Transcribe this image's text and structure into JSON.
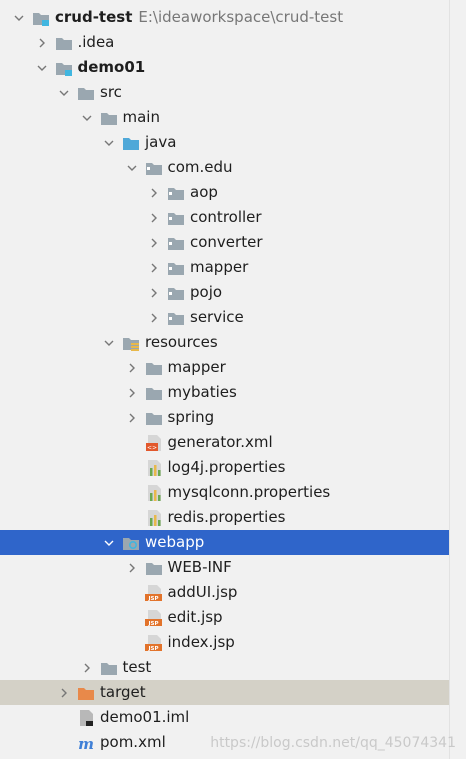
{
  "project": {
    "name": "crud-test",
    "path": "E:\\ideaworkspace\\crud-test"
  },
  "tree": [
    {
      "label": "crud-test",
      "depth": 0,
      "arrow": "down",
      "icon": "module-folder-icon",
      "bold": true,
      "path": "E:\\ideaworkspace\\crud-test"
    },
    {
      "label": ".idea",
      "depth": 1,
      "arrow": "right",
      "icon": "folder-icon"
    },
    {
      "label": "demo01",
      "depth": 1,
      "arrow": "down",
      "icon": "module-folder-icon",
      "bold": true
    },
    {
      "label": "src",
      "depth": 2,
      "arrow": "down",
      "icon": "folder-icon"
    },
    {
      "label": "main",
      "depth": 3,
      "arrow": "down",
      "icon": "folder-icon"
    },
    {
      "label": "java",
      "depth": 4,
      "arrow": "down",
      "icon": "source-folder-icon"
    },
    {
      "label": "com.edu",
      "depth": 5,
      "arrow": "down",
      "icon": "package-icon"
    },
    {
      "label": "aop",
      "depth": 6,
      "arrow": "right",
      "icon": "package-icon"
    },
    {
      "label": "controller",
      "depth": 6,
      "arrow": "right",
      "icon": "package-icon"
    },
    {
      "label": "converter",
      "depth": 6,
      "arrow": "right",
      "icon": "package-icon"
    },
    {
      "label": "mapper",
      "depth": 6,
      "arrow": "right",
      "icon": "package-icon"
    },
    {
      "label": "pojo",
      "depth": 6,
      "arrow": "right",
      "icon": "package-icon"
    },
    {
      "label": "service",
      "depth": 6,
      "arrow": "right",
      "icon": "package-icon"
    },
    {
      "label": "resources",
      "depth": 4,
      "arrow": "down",
      "icon": "resources-folder-icon"
    },
    {
      "label": "mapper",
      "depth": 5,
      "arrow": "right",
      "icon": "folder-icon"
    },
    {
      "label": "mybaties",
      "depth": 5,
      "arrow": "right",
      "icon": "folder-icon"
    },
    {
      "label": "spring",
      "depth": 5,
      "arrow": "right",
      "icon": "folder-icon"
    },
    {
      "label": "generator.xml",
      "depth": 5,
      "arrow": "none",
      "icon": "xml-file-icon"
    },
    {
      "label": "log4j.properties",
      "depth": 5,
      "arrow": "none",
      "icon": "properties-file-icon"
    },
    {
      "label": "mysqlconn.properties",
      "depth": 5,
      "arrow": "none",
      "icon": "properties-file-icon"
    },
    {
      "label": "redis.properties",
      "depth": 5,
      "arrow": "none",
      "icon": "properties-file-icon"
    },
    {
      "label": "webapp",
      "depth": 4,
      "arrow": "down",
      "icon": "web-folder-icon",
      "selected": true
    },
    {
      "label": "WEB-INF",
      "depth": 5,
      "arrow": "right",
      "icon": "folder-icon"
    },
    {
      "label": "addUI.jsp",
      "depth": 5,
      "arrow": "none",
      "icon": "jsp-file-icon"
    },
    {
      "label": "edit.jsp",
      "depth": 5,
      "arrow": "none",
      "icon": "jsp-file-icon"
    },
    {
      "label": "index.jsp",
      "depth": 5,
      "arrow": "none",
      "icon": "jsp-file-icon"
    },
    {
      "label": "test",
      "depth": 3,
      "arrow": "right",
      "icon": "folder-icon"
    },
    {
      "label": "target",
      "depth": 2,
      "arrow": "right",
      "icon": "excluded-folder-icon",
      "highlight": true
    },
    {
      "label": "demo01.iml",
      "depth": 2,
      "arrow": "none",
      "icon": "iml-file-icon"
    },
    {
      "label": "pom.xml",
      "depth": 2,
      "arrow": "none",
      "icon": "maven-file-icon"
    }
  ],
  "watermark": "https://blog.csdn.net/qq_45074341",
  "colors": {
    "selection": "#2f65ca",
    "highlight": "#d4d1c7",
    "folder": "#9aa7b0",
    "source": "#4fa8d8",
    "excluded": "#e8894a",
    "background": "#f1f1f1"
  }
}
